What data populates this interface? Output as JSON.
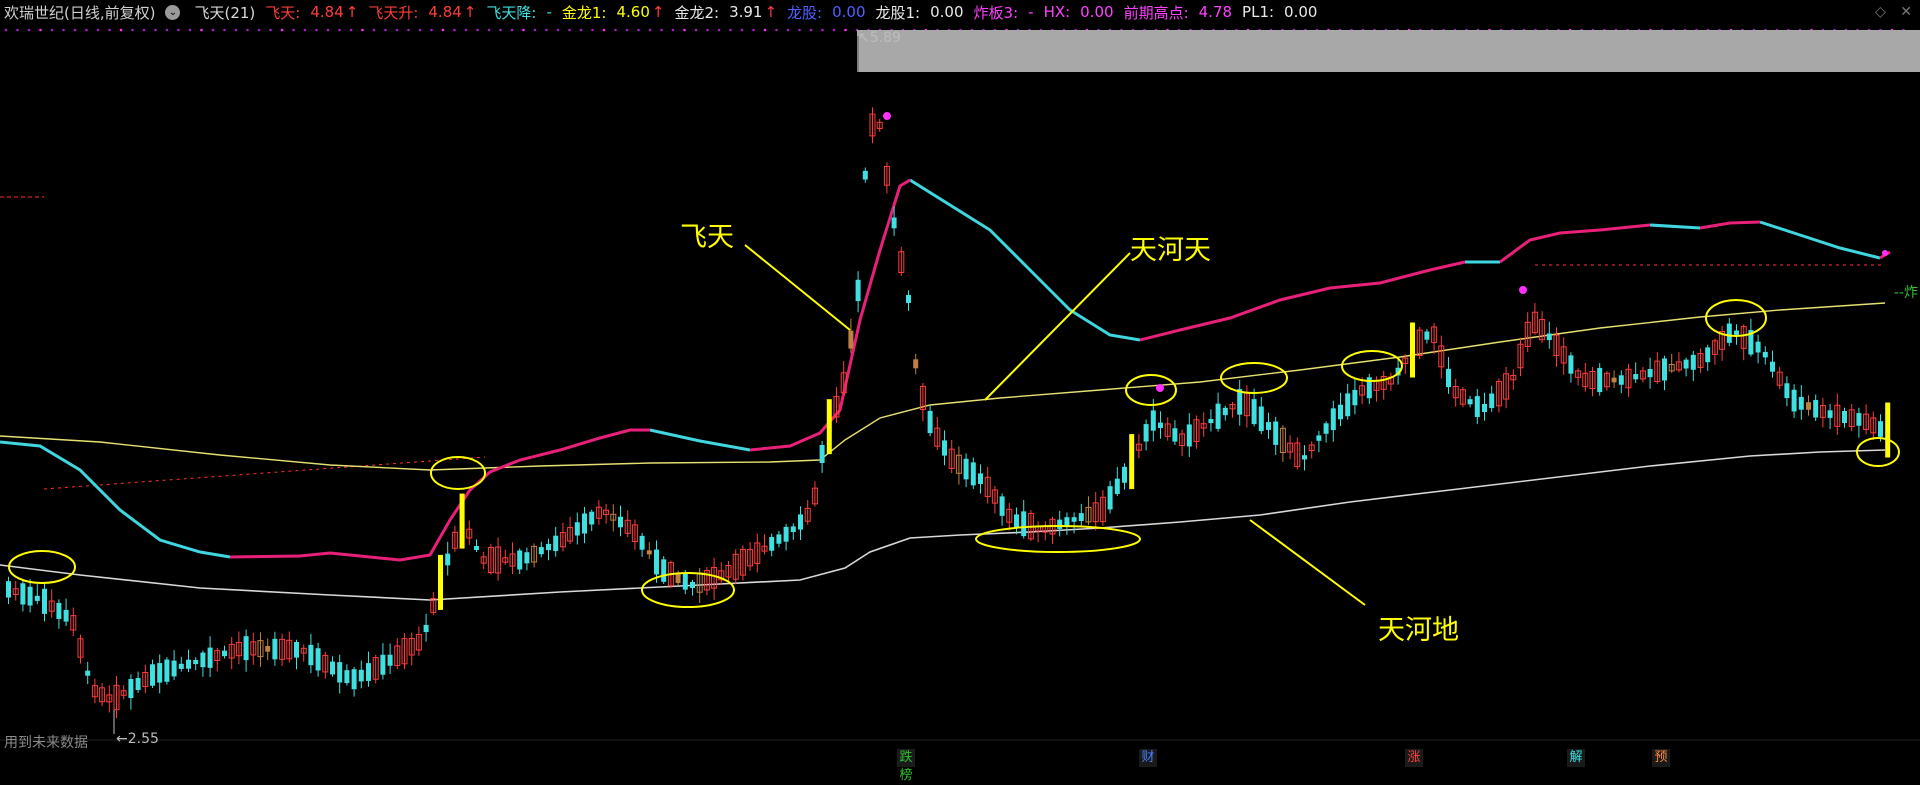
{
  "header": {
    "stock": "欢瑞世纪(日线,前复权)",
    "indicator": "飞天(21)",
    "items": [
      {
        "label": "飞天:",
        "value": "4.84",
        "arrow": "↑"
      },
      {
        "label": "飞天升:",
        "value": "4.84",
        "arrow": "↑"
      },
      {
        "label": "飞天降:",
        "value": "-"
      },
      {
        "label": "金龙1:",
        "value": "4.60",
        "arrow": "↑"
      },
      {
        "label": "金龙2:",
        "value": "3.91",
        "arrow": "↑"
      },
      {
        "label": "龙股:",
        "value": "0.00"
      },
      {
        "label": "龙股1:",
        "value": "0.00"
      },
      {
        "label": "炸板3:",
        "value": "-"
      },
      {
        "label": "HX:",
        "value": "0.00"
      },
      {
        "label": "前期高点:",
        "value": "4.78"
      },
      {
        "label": "PL1:",
        "value": "0.00"
      }
    ]
  },
  "annotations": {
    "feitian": "飞天",
    "tianhe_tian": "天河天",
    "tianhe_di": "天河地"
  },
  "marks": {
    "high": "5.89",
    "low": "2.55",
    "bottom_left": "用到未来数据",
    "right_tag": "--炸"
  },
  "events": [
    "跌榜",
    "财",
    "涨",
    "解",
    "预"
  ],
  "colors": {
    "up": "#ff3c3c",
    "down": "#3fe0e0",
    "highlight": "#ffff00",
    "line_magenta": "#e8207a",
    "line_cyan": "#3fd6e0",
    "line_white": "#d8d8d8",
    "line_yellow": "#e6e070"
  }
}
